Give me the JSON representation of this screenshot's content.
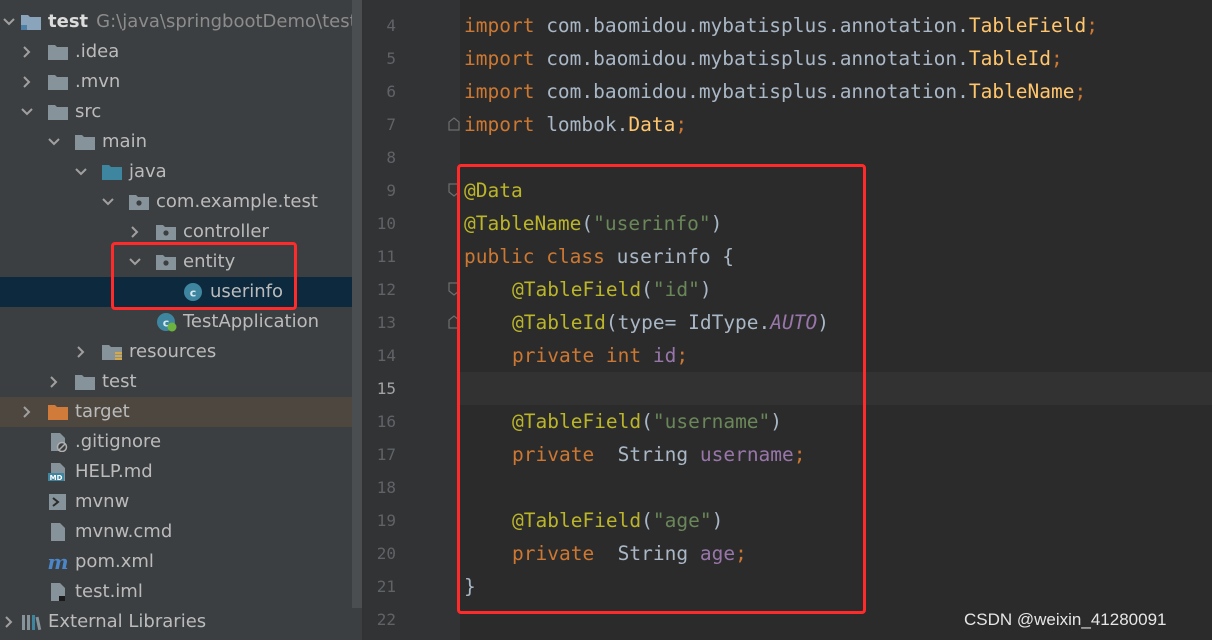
{
  "project_tree": {
    "root": {
      "name": "test",
      "path": "G:\\java\\springbootDemo\\test"
    },
    "items": [
      {
        "label": "test",
        "path": "G:\\java\\springbootDemo\\test",
        "icon": "module-folder-icon",
        "expanded": true
      },
      {
        "label": ".idea",
        "icon": "folder-icon",
        "expanded": false
      },
      {
        "label": ".mvn",
        "icon": "folder-icon",
        "expanded": false
      },
      {
        "label": "src",
        "icon": "folder-icon",
        "expanded": true
      },
      {
        "label": "main",
        "icon": "folder-icon",
        "expanded": true
      },
      {
        "label": "java",
        "icon": "source-folder-icon",
        "expanded": true
      },
      {
        "label": "com.example.test",
        "icon": "package-icon",
        "expanded": true
      },
      {
        "label": "controller",
        "icon": "package-icon",
        "expanded": false
      },
      {
        "label": "entity",
        "icon": "package-icon",
        "expanded": true
      },
      {
        "label": "userinfo",
        "icon": "class-icon",
        "selected": true
      },
      {
        "label": "TestApplication",
        "icon": "spring-class-icon"
      },
      {
        "label": "resources",
        "icon": "resources-folder-icon",
        "expanded": false
      },
      {
        "label": "test",
        "icon": "folder-icon",
        "expanded": false
      },
      {
        "label": "target",
        "icon": "excluded-folder-icon",
        "expanded": false
      },
      {
        "label": ".gitignore",
        "icon": "ignore-file-icon"
      },
      {
        "label": "HELP.md",
        "icon": "markdown-file-icon"
      },
      {
        "label": "mvnw",
        "icon": "shell-file-icon"
      },
      {
        "label": "mvnw.cmd",
        "icon": "text-file-icon"
      },
      {
        "label": "pom.xml",
        "icon": "maven-icon"
      },
      {
        "label": "test.iml",
        "icon": "iml-file-icon"
      },
      {
        "label": "External Libraries",
        "icon": "libraries-icon"
      }
    ]
  },
  "editor": {
    "current_line": 15,
    "line_numbers": [
      "4",
      "5",
      "6",
      "7",
      "8",
      "9",
      "10",
      "11",
      "12",
      "13",
      "14",
      "15",
      "16",
      "17",
      "18",
      "19",
      "20",
      "21",
      "22"
    ],
    "code": {
      "l4": {
        "kw": "import",
        "pkg": " com.baomidou.mybatisplus.annotation.",
        "cls": "TableField",
        "semi": ";"
      },
      "l5": {
        "kw": "import",
        "pkg": " com.baomidou.mybatisplus.annotation.",
        "cls": "TableId",
        "semi": ";"
      },
      "l6": {
        "kw": "import",
        "pkg": " com.baomidou.mybatisplus.annotation.",
        "cls": "TableName",
        "semi": ";"
      },
      "l7": {
        "kw": "import",
        "pkg": " lombok.",
        "cls": "Data",
        "semi": ";"
      },
      "l9": {
        "ann": "@Data"
      },
      "l10": {
        "ann": "@TableName",
        "open": "(",
        "str": "\"userinfo\"",
        "close": ")"
      },
      "l11": {
        "kw1": "public",
        "kw2": " class",
        "rest": " userinfo {"
      },
      "l12": {
        "ann": "@TableField",
        "open": "(",
        "str": "\"id\"",
        "close": ")"
      },
      "l13": {
        "ann": "@TableId",
        "mid": "(type= IdType.",
        "cst": "AUTO",
        "close": ")"
      },
      "l14": {
        "kw1": "private",
        "kw2": " int",
        "fld": " id",
        "semi": ";"
      },
      "l16": {
        "ann": "@TableField",
        "open": "(",
        "str": "\"username\"",
        "close": ")"
      },
      "l17": {
        "kw": "private",
        "type": "  String ",
        "fld": "username",
        "semi": ";"
      },
      "l19": {
        "ann": "@TableField",
        "open": "(",
        "str": "\"age\"",
        "close": ")"
      },
      "l20": {
        "kw": "private",
        "type": "  String ",
        "fld": "age",
        "semi": ";"
      },
      "l21": {
        "close_brace": "}"
      }
    }
  },
  "watermark": "CSDN @weixin_41280091",
  "colors": {
    "keyword": "#cc7832",
    "annotation": "#bbb529",
    "string": "#6a8759",
    "field": "#9876aa",
    "highlight_box": "#ff2a2a"
  }
}
